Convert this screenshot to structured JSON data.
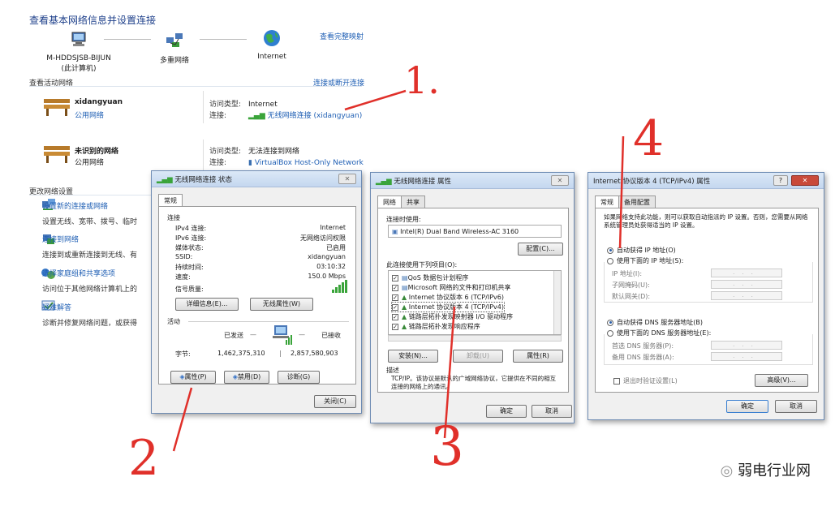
{
  "network_center": {
    "title": "查看基本网络信息并设置连接",
    "view_full_map": "查看完整映射",
    "nodes": [
      {
        "label": "M-HDDSJSB-BIJUN",
        "sub": "(此计算机)"
      },
      {
        "label": "多重网络",
        "sub": ""
      },
      {
        "label": "Internet",
        "sub": ""
      }
    ],
    "active_networks_label": "查看活动网络",
    "connect_disconnect": "连接或断开连接",
    "networks": [
      {
        "name": "xidangyuan",
        "type": "公用网络",
        "access_label": "访问类型:",
        "access_value": "Internet",
        "conn_label": "连接:",
        "conn_value": "无线网络连接 (xidangyuan)"
      },
      {
        "name": "未识别的网络",
        "type": "公用网络",
        "access_label": "访问类型:",
        "access_value": "无法连接到网络",
        "conn_label": "连接:",
        "conn_value": "VirtualBox Host-Only Network"
      }
    ],
    "change_settings_label": "更改网络设置",
    "tasks": [
      {
        "title": "设置新的连接或网络",
        "desc": "设置无线、宽带、拨号、临时"
      },
      {
        "title": "连接到网络",
        "desc": "连接到或重新连接到无线、有"
      },
      {
        "title": "选择家庭组和共享选项",
        "desc": "访问位于其他网络计算机上的"
      },
      {
        "title": "疑难解答",
        "desc": "诊断并修复网络问题，或获得"
      }
    ]
  },
  "status_dialog": {
    "title": "无线网络连接 状态",
    "tab": "常规",
    "connection_label": "连接",
    "rows": [
      {
        "k": "IPv4 连接:",
        "v": "Internet"
      },
      {
        "k": "IPv6 连接:",
        "v": "无网络访问权限"
      },
      {
        "k": "媒体状态:",
        "v": "已启用"
      },
      {
        "k": "SSID:",
        "v": "xidangyuan"
      },
      {
        "k": "持续时间:",
        "v": "03:10:32"
      },
      {
        "k": "速度:",
        "v": "150.0 Mbps"
      }
    ],
    "signal_label": "信号质量:",
    "details_btn": "详细信息(E)...",
    "wireless_props_btn": "无线属性(W)",
    "activity_label": "活动",
    "sent_label": "已发送",
    "received_label": "已接收",
    "bytes_label": "字节:",
    "bytes_sent": "1,462,375,310",
    "bytes_received": "2,857,580,903",
    "props_btn": "属性(P)",
    "disable_btn": "禁用(D)",
    "diagnose_btn": "诊断(G)",
    "close_btn": "关闭(C)"
  },
  "props_dialog": {
    "title": "无线网络连接 属性",
    "tabs": [
      "网络",
      "共享"
    ],
    "connect_using_label": "连接时使用:",
    "adapter": "Intel(R) Dual Band Wireless-AC 3160",
    "configure_btn": "配置(C)...",
    "items_label": "此连接使用下列项目(O):",
    "items": [
      "QoS 数据包计划程序",
      "Microsoft 网络的文件和打印机共享",
      "Internet 协议版本 6 (TCP/IPv6)",
      "Internet 协议版本 4 (TCP/IPv4)",
      "链路层拓扑发现映射器 I/O 驱动程序",
      "链路层拓扑发现响应程序"
    ],
    "install_btn": "安装(N)...",
    "uninstall_btn": "卸载(U)",
    "properties_btn": "属性(R)",
    "description_label": "描述",
    "description": "TCP/IP。该协议是默认的广域网络协议，它提供在不同的相互连接的网络上的通讯。",
    "ok_btn": "确定",
    "cancel_btn": "取消"
  },
  "ipv4_dialog": {
    "title": "Internet 协议版本 4 (TCP/IPv4) 属性",
    "help": "?",
    "tabs": [
      "常规",
      "备用配置"
    ],
    "intro": "如果网络支持此功能，则可以获取自动指派的 IP 设置。否则，您需要从网络系统管理员处获得适当的 IP 设置。",
    "auto_ip": "自动获得 IP 地址(O)",
    "manual_ip": "使用下面的 IP 地址(S):",
    "ip_label": "IP 地址(I):",
    "mask_label": "子网掩码(U):",
    "gateway_label": "默认网关(D):",
    "auto_dns": "自动获得 DNS 服务器地址(B)",
    "manual_dns": "使用下面的 DNS 服务器地址(E):",
    "pref_dns": "首选 DNS 服务器(P):",
    "alt_dns": "备用 DNS 服务器(A):",
    "validate": "退出时验证设置(L)",
    "advanced_btn": "高级(V)...",
    "ok_btn": "确定",
    "cancel_btn": "取消"
  },
  "annotations": {
    "a1": "1.",
    "a2": "2",
    "a3": "3",
    "a4": "4"
  },
  "watermark": "弱电行业网"
}
